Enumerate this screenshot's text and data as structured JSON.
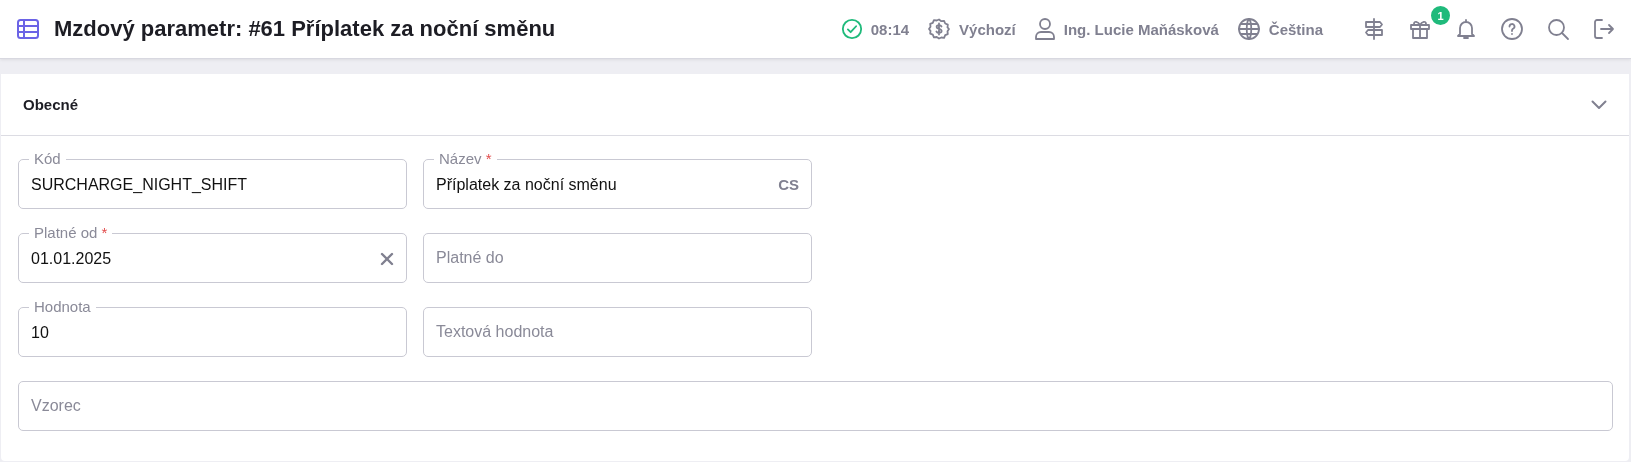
{
  "header": {
    "title": "Mzdový parametr: #61 Příplatek za noční směnu",
    "status": {
      "time": "08:14"
    },
    "currency": "Výchozí",
    "user": "Ing. Lucie Maňásková",
    "language": "Čeština",
    "gift_badge": "1"
  },
  "section": {
    "title": "Obecné",
    "expanded": true
  },
  "fields": [
    {
      "label": "Kód",
      "value": "SURCHARGE_NIGHT_SHIFT",
      "required": false,
      "wide": false
    },
    {
      "label": "Název",
      "value": "Příplatek za noční směnu",
      "required": true,
      "required_mark": "*",
      "suffix": "CS",
      "wide": false
    },
    {
      "label": "Platné od",
      "value": "01.01.2025",
      "required": true,
      "required_mark": "*",
      "clearable": true,
      "wide": false
    },
    {
      "placeholder": "Platné do",
      "wide": false
    },
    {
      "label": "Hodnota",
      "value": "10",
      "required": false,
      "wide": false
    },
    {
      "placeholder": "Textová hodnota",
      "wide": false
    },
    {
      "placeholder": "Vzorec",
      "wide": true
    }
  ]
}
